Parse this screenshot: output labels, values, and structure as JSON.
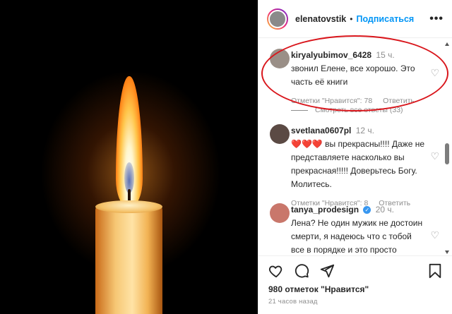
{
  "post": {
    "username": "elenatovstik",
    "separator": "•",
    "follow_label": "Подписаться",
    "more_label": "•••",
    "likes": "980 отметок \"Нравится\"",
    "time_ago": "21 часов назад"
  },
  "comments": [
    {
      "username": "kiryalyubimov_6428",
      "time": "15 ч.",
      "text": "звонил Елене, все хорошо. Это часть её книги",
      "likes_label": "Отметки \"Нравится\": 78",
      "reply_label": "Ответить",
      "avatar_color": "#9a8f87"
    },
    {
      "username": "svetlana0607pl",
      "time": "12 ч.",
      "hearts": "❤️❤️❤️",
      "text": "вы прекрасны!!!! Даже не представляете насколько вы прекрасная!!!!! Доверьтесь Богу. Молитесь.",
      "likes_label": "Отметки \"Нравится\": 8",
      "reply_label": "Ответить",
      "avatar_color": "#5b4a44"
    },
    {
      "username": "tanya_prodesign",
      "time": "20 ч.",
      "text": "Лена? Не один мужик не достоин смерти, я надеюсь что с тобой все в порядке и это просто манипуляция",
      "avatar_color": "#c9776b"
    }
  ],
  "view_replies_label": "Смотреть все ответы (33)",
  "icons": {
    "like": "heart-icon",
    "comment": "comment-icon",
    "share": "share-icon",
    "save": "bookmark-icon"
  },
  "colors": {
    "follow": "#0095f6",
    "highlight": "#d9161c",
    "verified": "#3897f0"
  }
}
